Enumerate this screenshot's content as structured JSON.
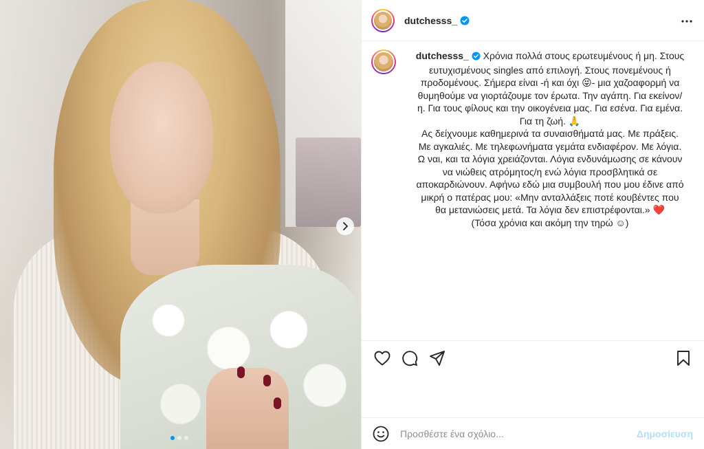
{
  "post": {
    "username": "dutchesss_",
    "verified": true,
    "caption_lines": [
      "Χρόνια πολλά στους ερωτευμένους ή μη. Στους",
      "ευτυχισμένους singles από επιλογή. Στους πονεμένους ή",
      "προδομένους. Σήμερα είναι -ή και όχι 😝- μια χαζοαφορμή να",
      "θυμηθούμε να γιορτάζουμε τον έρωτα. Την αγάπη. Για εκείνον/",
      "η. Για τους φίλους και την οικογένεια μας. Για εσένα. Για εμένα.",
      "Για τη ζωή. 🙏",
      "Ας δείχνουμε καθημερινά τα συναισθήματά μας. Με πράξεις.",
      "Με αγκαλιές. Με τηλεφωνήματα γεμάτα ενδιαφέρον. Με λόγια.",
      "Ω ναι, και τα λόγια χρειάζονται. Λόγια ενδυνάμωσης σε κάνουν",
      "να νιώθεις ατρόμητος/η ενώ λόγια προσβλητικά σε",
      "αποκαρδιώνουν. Αφήνω εδώ μια συμβουλή που μου έδινε από",
      "μικρή ο πατέρας μου: «Μην ανταλλάξεις ποτέ κουβέντες που",
      "θα μετανιώσεις μετά. Τα λόγια δεν επιστρέφονται.» ❤️",
      "(Τόσα χρόνια και ακόμη την τηρώ ☺)"
    ],
    "carousel": {
      "count": 3,
      "active_index": 0
    }
  },
  "comment": {
    "placeholder": "Προσθέστε ένα σχόλιο...",
    "post_label": "Δημοσίευση"
  },
  "icons": {
    "verified": "verified-badge-icon",
    "more": "more-options-icon",
    "like": "heart-icon",
    "comment": "comment-icon",
    "share": "share-icon",
    "save": "bookmark-icon",
    "emoji": "emoji-icon",
    "next": "chevron-right-icon"
  },
  "colors": {
    "verified": "#0095f6",
    "post_button_disabled": "#b2dffc",
    "carousel_active": "#0095f6"
  }
}
